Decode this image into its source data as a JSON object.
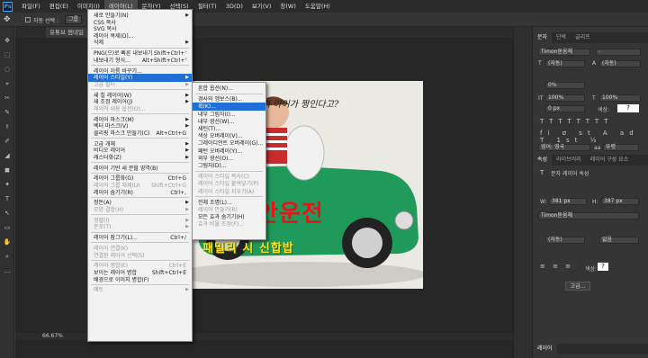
{
  "menubar": {
    "logo": "Ps",
    "items": [
      "파일(F)",
      "편집(E)",
      "이미지(I)",
      "레이어(L)",
      "문자(Y)",
      "선택(S)",
      "필터(T)",
      "3D(D)",
      "보기(V)",
      "창(W)",
      "도움말(H)"
    ]
  },
  "options": {
    "auto_select": "자동 선택 :",
    "group": "그룹",
    "show_transform": "변형 컨트롤 표시"
  },
  "document": {
    "tab_title": "유튜브 썸네일",
    "other_tab": "불편.png"
  },
  "status": {
    "zoom": "66.67%"
  },
  "photo_overlay": {
    "headline": "이 아이가 짱인다고?",
    "title_red": "안운전",
    "subtitle": "패밀리 시 신합밥"
  },
  "layer_menu": [
    {
      "label": "새로 만들기(N)",
      "arrow": true
    },
    {
      "label": "CSS 복사"
    },
    {
      "label": "SVG 복사"
    },
    {
      "label": "레이어 복제(D)..."
    },
    {
      "label": "삭제",
      "arrow": true
    },
    {
      "sep": true
    },
    {
      "label": "PNG(으)로 빠른 내보내기",
      "shortcut": "Shift+Ctrl+'"
    },
    {
      "label": "내보내기 형식...",
      "shortcut": "Alt+Shift+Ctrl+'"
    },
    {
      "sep": true
    },
    {
      "label": "레이어 이름 바꾸기..."
    },
    {
      "label": "레이어 스타일(Y)",
      "arrow": true,
      "highlight": true
    },
    {
      "label": "고급 필터",
      "disabled": true,
      "arrow": true
    },
    {
      "sep": true
    },
    {
      "label": "새 칠 레이어(W)",
      "arrow": true
    },
    {
      "label": "새 조정 레이어(J)",
      "arrow": true
    },
    {
      "label": "레이어 내용 옵션(O)...",
      "disabled": true
    },
    {
      "sep": true
    },
    {
      "label": "레이어 마스크(M)",
      "arrow": true
    },
    {
      "label": "벡터 마스크(V)",
      "arrow": true
    },
    {
      "label": "클리핑 마스크 만들기(C)",
      "shortcut": "Alt+Ctrl+G"
    },
    {
      "sep": true
    },
    {
      "label": "고급 개체",
      "arrow": true
    },
    {
      "label": "비디오 레이어",
      "arrow": true
    },
    {
      "label": "래스터화(Z)",
      "arrow": true
    },
    {
      "sep": true
    },
    {
      "label": "레이어 기반 새 분할 영역(B)"
    },
    {
      "sep": true
    },
    {
      "label": "레이어 그룹화(G)",
      "shortcut": "Ctrl+G"
    },
    {
      "label": "레이어 그룹 해제(U)",
      "shortcut": "Shift+Ctrl+G",
      "disabled": true
    },
    {
      "label": "레이어 숨기기(R)",
      "shortcut": "Ctrl+,"
    },
    {
      "sep": true
    },
    {
      "label": "정돈(A)",
      "arrow": true
    },
    {
      "label": "모양 결합(H)",
      "disabled": true,
      "arrow": true
    },
    {
      "sep": true
    },
    {
      "label": "정렬(I)",
      "disabled": true,
      "arrow": true
    },
    {
      "label": "분포(T)",
      "disabled": true,
      "arrow": true
    },
    {
      "sep": true
    },
    {
      "label": "레이어 잠그기(L)...",
      "shortcut": "Ctrl+/"
    },
    {
      "sep": true
    },
    {
      "label": "레이어 연결(K)",
      "disabled": true
    },
    {
      "label": "연결된 레이어 선택(S)",
      "disabled": true
    },
    {
      "sep": true
    },
    {
      "label": "레이어 병합(E)",
      "shortcut": "Ctrl+E",
      "disabled": true
    },
    {
      "label": "보이는 레이어 병합",
      "shortcut": "Shift+Ctrl+E"
    },
    {
      "label": "배경으로 이미지 병합(F)"
    },
    {
      "sep": true
    },
    {
      "label": "매트",
      "disabled": true,
      "arrow": true
    }
  ],
  "style_submenu": [
    {
      "label": "혼합 옵션(N)..."
    },
    {
      "sep": true
    },
    {
      "label": "경사와 엠보스(B)..."
    },
    {
      "label": "획(K)...",
      "highlight": true
    },
    {
      "label": "내부 그림자(I)..."
    },
    {
      "label": "내부 광선(W)..."
    },
    {
      "label": "새틴(T)..."
    },
    {
      "label": "색상 오버레이(V)..."
    },
    {
      "label": "그레이디언트 오버레이(G)..."
    },
    {
      "label": "패턴 오버레이(Y)..."
    },
    {
      "label": "외부 광선(O)..."
    },
    {
      "label": "그림자(D)..."
    },
    {
      "sep": true
    },
    {
      "label": "레이어 스타일 복사(C)",
      "disabled": true
    },
    {
      "label": "레이어 스타일 붙여넣기(P)",
      "disabled": true
    },
    {
      "label": "레이어 스타일 지우기(A)",
      "disabled": true
    },
    {
      "sep": true
    },
    {
      "label": "전체 조명(L)..."
    },
    {
      "label": "레이어 만들기(R)",
      "disabled": true
    },
    {
      "label": "모든 효과 숨기기(H)"
    },
    {
      "label": "효과 비율 조정(F)...",
      "disabled": true
    }
  ],
  "panel": {
    "tabs1": [
      "문자",
      "단락",
      "글리프"
    ],
    "font": "Timon돋움체",
    "font_style": "-",
    "size": "(자동)",
    "leading": "(자동)",
    "kerning": "0%",
    "scale_v": "100%",
    "scale_h": "100%",
    "baseline": "0 px",
    "color_label": "색상:",
    "lang": "영어: 영국",
    "aa": "뚜렷",
    "tabs2": [
      "속성",
      "라이브러리",
      "레이어 구성 요소"
    ],
    "props_title": "문자 레이어 속성",
    "w_label": "W:",
    "w": "381 px",
    "h_label": "H:",
    "h": "387 px",
    "font2": "Timon돋움체",
    "size2": "(자동)",
    "aa2": "없음",
    "color2": "색상:",
    "advanced": "고급...",
    "layers_tab": "레이어"
  }
}
